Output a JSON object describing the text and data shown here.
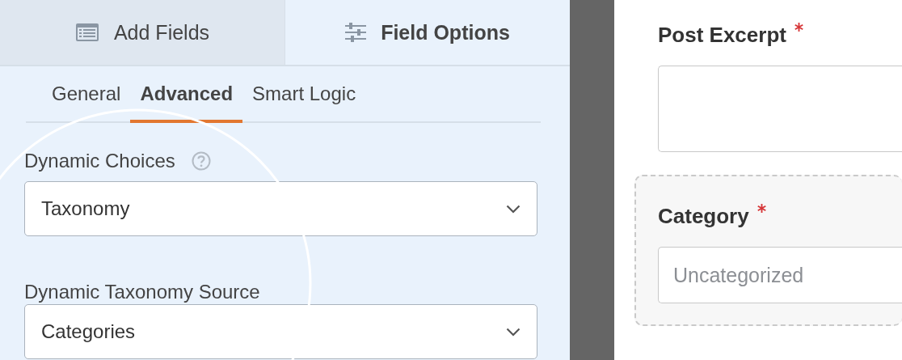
{
  "sidebar": {
    "tabs": [
      {
        "label": "Add Fields",
        "selected": false
      },
      {
        "label": "Field Options",
        "selected": true
      }
    ],
    "subtabs": [
      {
        "label": "General",
        "selected": false
      },
      {
        "label": "Advanced",
        "selected": true
      },
      {
        "label": "Smart Logic",
        "selected": false
      }
    ],
    "fields": [
      {
        "label": "Dynamic Choices",
        "help": true,
        "value": "Taxonomy"
      },
      {
        "label": "Dynamic Taxonomy Source",
        "help": false,
        "value": "Categories"
      }
    ]
  },
  "form": {
    "fields": [
      {
        "kind": "textarea",
        "label": "Post Excerpt",
        "required": true,
        "selected": false
      },
      {
        "kind": "input",
        "label": "Category",
        "required": true,
        "placeholder": "Uncategorized",
        "selected": true
      }
    ]
  }
}
